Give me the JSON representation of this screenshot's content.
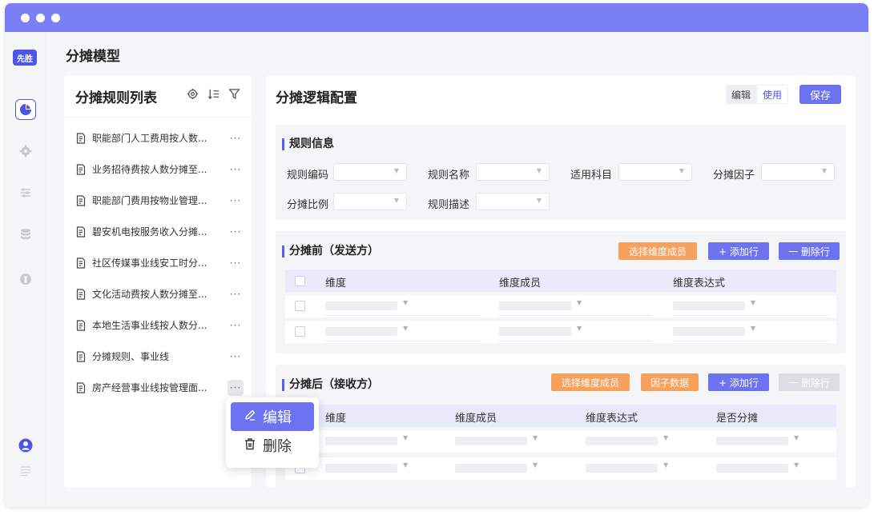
{
  "app": {
    "logo_text": "先胜",
    "page_title": "分摊模型"
  },
  "sidebar": {
    "icons": [
      "pie-chart-icon",
      "gear-icon",
      "sliders-icon",
      "database-icon",
      "bulb-icon",
      "user-icon",
      "menu-lines-icon"
    ]
  },
  "rule_list": {
    "title": "分摊规则列表",
    "items": [
      "职能部门人工费用按人数...",
      "业务招待费按人数分摊至...",
      "职能部门费用按物业管理...",
      "碧安机电按服务收入分摊...",
      "社区传媒事业线安工时分...",
      "文化活动费按人数分摊至...",
      "本地生活事业线按人数分...",
      "分摊规则、事业线",
      "房产经营事业线按管理面..."
    ],
    "more": "···"
  },
  "context_menu": {
    "edit": "编辑",
    "delete": "删除"
  },
  "config": {
    "title": "分摊逻辑配置",
    "mode_edit": "编辑",
    "mode_use": "使用",
    "save": "保存",
    "rule_info": {
      "title": "规则信息",
      "code_label": "规则编码",
      "name_label": "规则名称",
      "subject_label": "适用科目",
      "factor_label": "分摊因子",
      "ratio_label": "分摊比例",
      "desc_label": "规则描述"
    },
    "before": {
      "title": "分摊前（发送方）",
      "select_btn": "选择维度成员",
      "add_btn": "+ 添加行",
      "del_btn": "一 删除行",
      "columns": [
        "维度",
        "维度成员",
        "维度表达式"
      ]
    },
    "after": {
      "title": "分摊后（接收方）",
      "select_btn": "选择维度成员",
      "factor_btn": "因子数据",
      "add_btn": "+ 添加行",
      "del_btn": "一 删除行",
      "columns": [
        "维度",
        "维度成员",
        "维度表达式",
        "是否分摊"
      ]
    }
  },
  "colors": {
    "accent": "#6d72f0",
    "titlebar": "#7b7ff5",
    "orange": "#f7a15d"
  }
}
